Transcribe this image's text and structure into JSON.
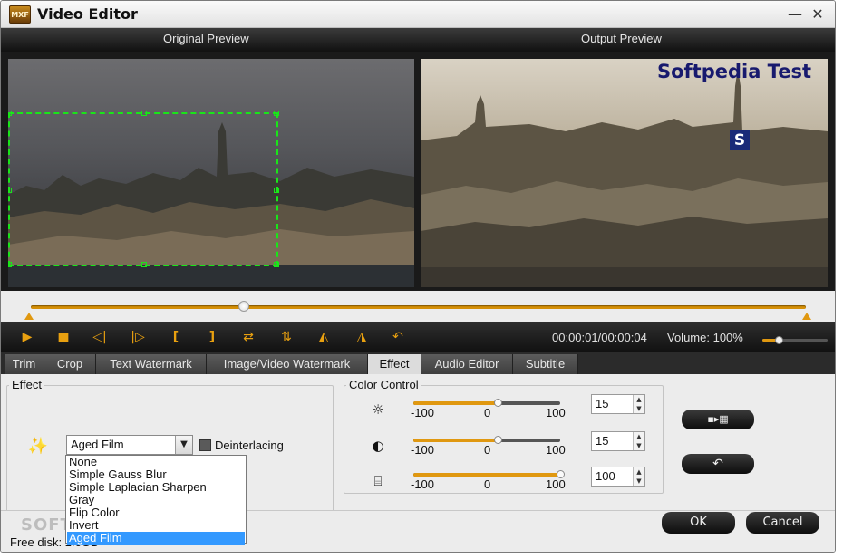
{
  "window": {
    "title": "Video Editor",
    "app_icon_text": "MXF",
    "minimize_symbol": "—",
    "close_symbol": "✕"
  },
  "preview": {
    "original_label": "Original Preview",
    "output_label": "Output Preview",
    "watermark_text": "Softpedia Test",
    "watermark_logo": "S"
  },
  "timeline": {
    "position_fraction": 0.275
  },
  "controls": {
    "play_icon": "▶",
    "stop_icon": "■",
    "prev_frame_icon": "◁|",
    "next_frame_icon": "|▷",
    "mark_in_icon": "[",
    "mark_out_icon": "]",
    "swap_icon": "⇄",
    "split_icon": "⇅",
    "flip_h_icon": "◭",
    "flip_v_icon": "◮",
    "undo_icon": "↶",
    "time": "00:00:01/00:00:04",
    "volume_label": "Volume: 100%",
    "volume_fraction": 0.25
  },
  "tabs": [
    {
      "label": "Trim"
    },
    {
      "label": "Crop"
    },
    {
      "label": "Text Watermark"
    },
    {
      "label": "Image/Video Watermark"
    },
    {
      "label": "Effect"
    },
    {
      "label": "Audio Editor"
    },
    {
      "label": "Subtitle"
    }
  ],
  "effect": {
    "group_label": "Effect",
    "icon": "✨",
    "selected": "Aged Film",
    "arrow": "▼",
    "deinterlacing_label": "Deinterlacing",
    "options": [
      "None",
      "Simple Gauss Blur",
      "Simple Laplacian Sharpen",
      "Gray",
      "Flip Color",
      "Invert",
      "Aged Film"
    ]
  },
  "color_control": {
    "group_label": "Color Control",
    "sliders": [
      {
        "icon": "☼",
        "min_label": "-100",
        "mid_label": "0",
        "max_label": "100",
        "value": 15
      },
      {
        "icon": "◐",
        "min_label": "-100",
        "mid_label": "0",
        "max_label": "100",
        "value": 15
      },
      {
        "icon": "⌸",
        "min_label": "-100",
        "mid_label": "0",
        "max_label": "100",
        "value": 100
      }
    ],
    "spin_up": "▲",
    "spin_down": "▼"
  },
  "side_buttons": {
    "apply_all_icon": "▪▸▦",
    "reset_icon": "↶"
  },
  "footer": {
    "ok_label": "OK",
    "cancel_label": "Cancel",
    "watermark": "SOFTPEDIA",
    "status": "Free disk: 1.6GB"
  }
}
